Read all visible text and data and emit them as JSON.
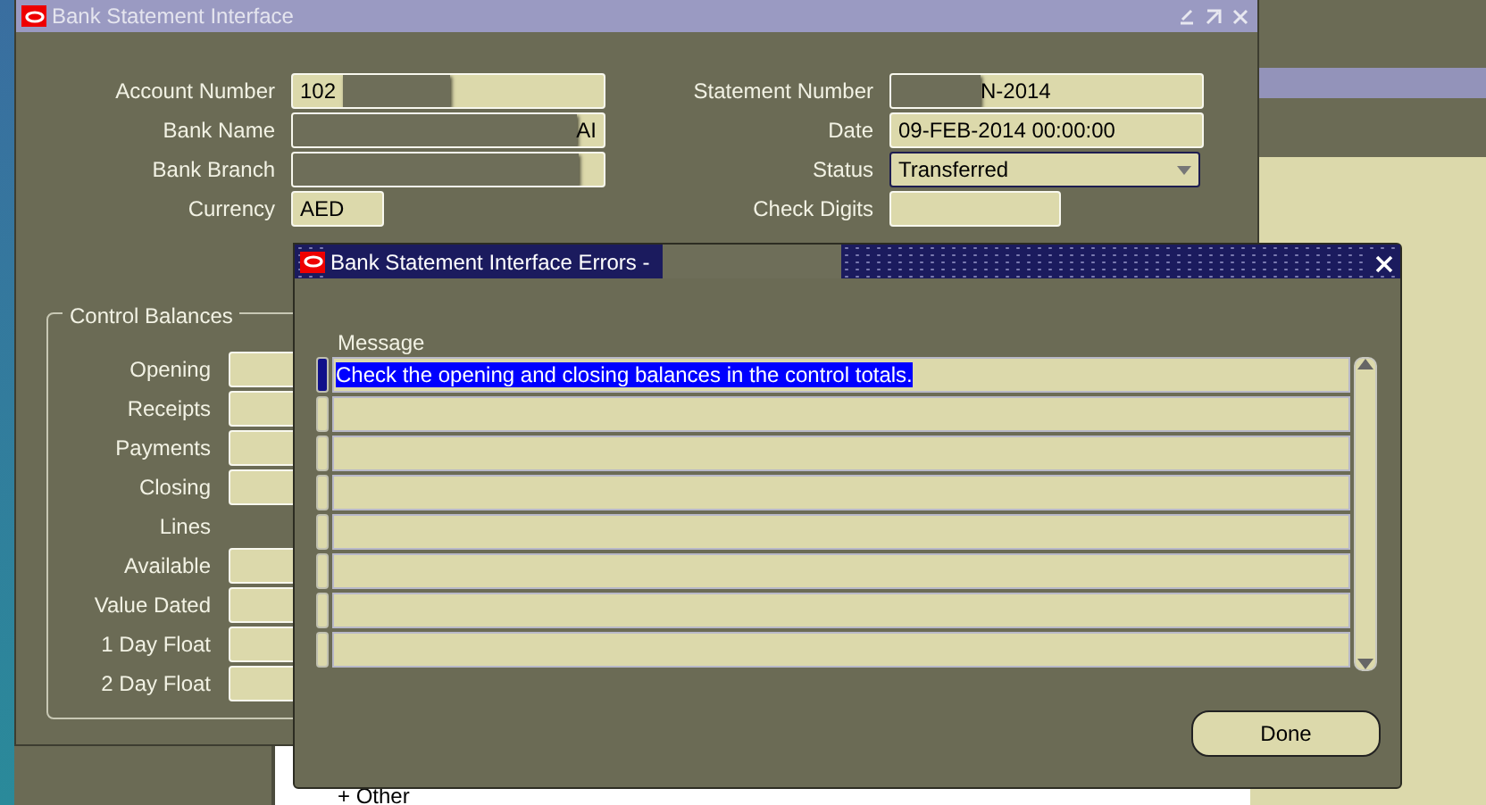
{
  "main_window": {
    "title": "Bank Statement Interface",
    "fields_left": [
      {
        "label": "Account Number",
        "value": "102",
        "kind": "wide"
      },
      {
        "label": "Bank Name",
        "value": "AI",
        "kind": "wide",
        "right_aligned": true
      },
      {
        "label": "Bank Branch",
        "kind": "wide"
      },
      {
        "label": "Currency",
        "value": "AED",
        "kind": "short"
      }
    ],
    "fields_right": [
      {
        "label": "Statement Number",
        "value": "N-2014",
        "kind": "wide"
      },
      {
        "label": "Date",
        "value": "09-FEB-2014 00:00:00",
        "kind": "wide"
      },
      {
        "label": "Status",
        "value": "Transferred",
        "kind": "select"
      },
      {
        "label": "Check Digits",
        "kind": "medium"
      }
    ],
    "control_balances": {
      "title": "Control Balances",
      "rows": [
        {
          "label": "Opening",
          "kind": "field"
        },
        {
          "label": "Receipts",
          "kind": "field"
        },
        {
          "label": "Payments",
          "kind": "field"
        },
        {
          "label": "Closing",
          "kind": "field"
        },
        {
          "label": "Lines",
          "kind": "label"
        },
        {
          "label": "Available",
          "kind": "field"
        },
        {
          "label": "Value Dated",
          "kind": "field"
        },
        {
          "label": "1 Day Float",
          "kind": "field"
        },
        {
          "label": "2 Day Float",
          "kind": "field"
        }
      ]
    }
  },
  "error_dialog": {
    "title": "Bank Statement Interface Errors -",
    "column": "Message",
    "rows": [
      {
        "message": "Check the opening and closing balances in the control totals.",
        "selected": true
      },
      {
        "selected": false
      },
      {
        "selected": false
      },
      {
        "selected": false
      },
      {
        "selected": false
      },
      {
        "selected": false
      },
      {
        "selected": false
      },
      {
        "selected": false
      }
    ],
    "button": "Done"
  },
  "background_tree": {
    "item": "+ Other"
  }
}
